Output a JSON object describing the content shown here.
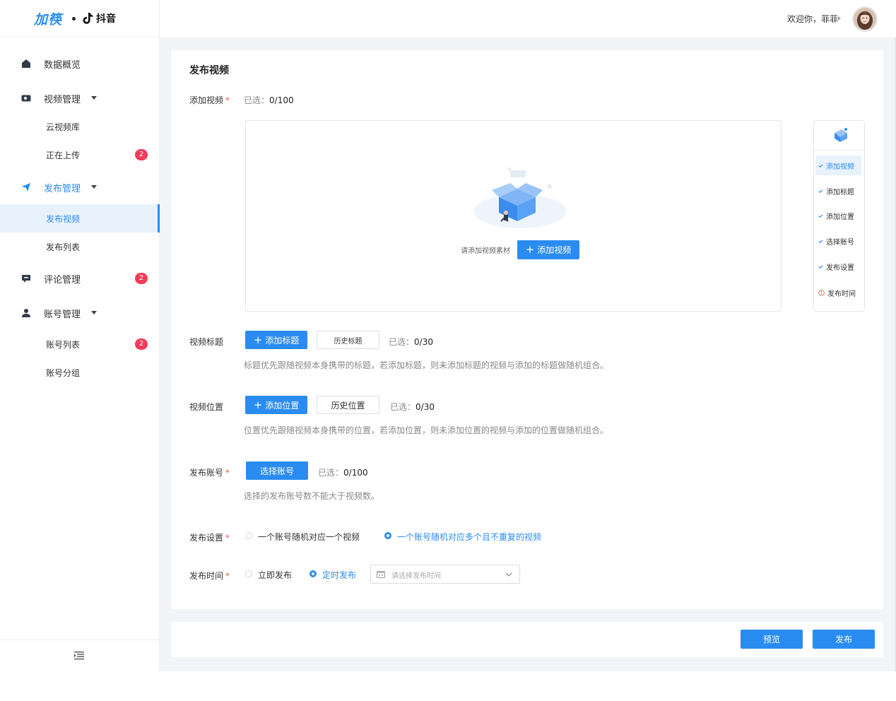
{
  "logo": {
    "brand": "加筷",
    "partner": "抖音"
  },
  "header": {
    "welcome": "欢迎你，菲菲"
  },
  "sidebar": {
    "items": [
      {
        "label": "数据概览",
        "icon": "home-icon"
      },
      {
        "label": "视频管理",
        "icon": "video-icon"
      },
      {
        "label": "云视频库"
      },
      {
        "label": "正在上传",
        "badge": "2"
      },
      {
        "label": "发布管理",
        "icon": "send-icon"
      },
      {
        "label": "发布视频"
      },
      {
        "label": "发布列表"
      },
      {
        "label": "评论管理",
        "icon": "comment-icon",
        "badge": "2"
      },
      {
        "label": "账号管理",
        "icon": "user-icon"
      },
      {
        "label": "账号列表",
        "badge": "2"
      },
      {
        "label": "账号分组"
      }
    ]
  },
  "main": {
    "title": "发布视频",
    "add_video": {
      "label": "添加视频",
      "selected_prefix": "已选：",
      "selected": "0/100",
      "hint": "请添加视频素材",
      "button": "添加视频"
    },
    "video_title": {
      "label": "视频标题",
      "add_button": "添加标题",
      "history_button": "历史标题",
      "selected_prefix": "已选：",
      "selected": "0/30",
      "hint": "标题优先跟随视频本身携带的标题，若添加标题，则未添加标题的视频与添加的标题做随机组合。"
    },
    "video_location": {
      "label": "视频位置",
      "add_button": "添加位置",
      "history_button": "历史位置",
      "selected_prefix": "已选：",
      "selected": "0/30",
      "hint": "位置优先跟随视频本身携带的位置，若添加位置，则未添加位置的视频与添加的位置做随机组合。"
    },
    "publish_account": {
      "label": "发布账号",
      "button": "选择账号",
      "selected_prefix": "已选：",
      "selected": "0/100",
      "hint": "选择的发布账号数不能大于视频数。"
    },
    "publish_setting": {
      "label": "发布设置",
      "option1": "一个账号随机对应一个视频",
      "option2": "一个账号随机对应多个且不重复的视频",
      "selected": "option2"
    },
    "publish_time": {
      "label": "发布时间",
      "option1": "立即发布",
      "option2": "定时发布",
      "selected": "option2",
      "date_placeholder": "请选择发布时间"
    }
  },
  "steps": [
    {
      "label": "添加视频",
      "status": "active"
    },
    {
      "label": "添加标题",
      "status": "done"
    },
    {
      "label": "添加位置",
      "status": "done"
    },
    {
      "label": "选择账号",
      "status": "done"
    },
    {
      "label": "发布设置",
      "status": "done"
    },
    {
      "label": "发布时间",
      "status": "error"
    }
  ],
  "footer": {
    "preview": "预览",
    "publish": "发布"
  },
  "colors": {
    "primary": "#2a8cf0",
    "badge": "#f23b5a",
    "required": "#f05a4a",
    "active_bg": "#e8f2fd"
  }
}
